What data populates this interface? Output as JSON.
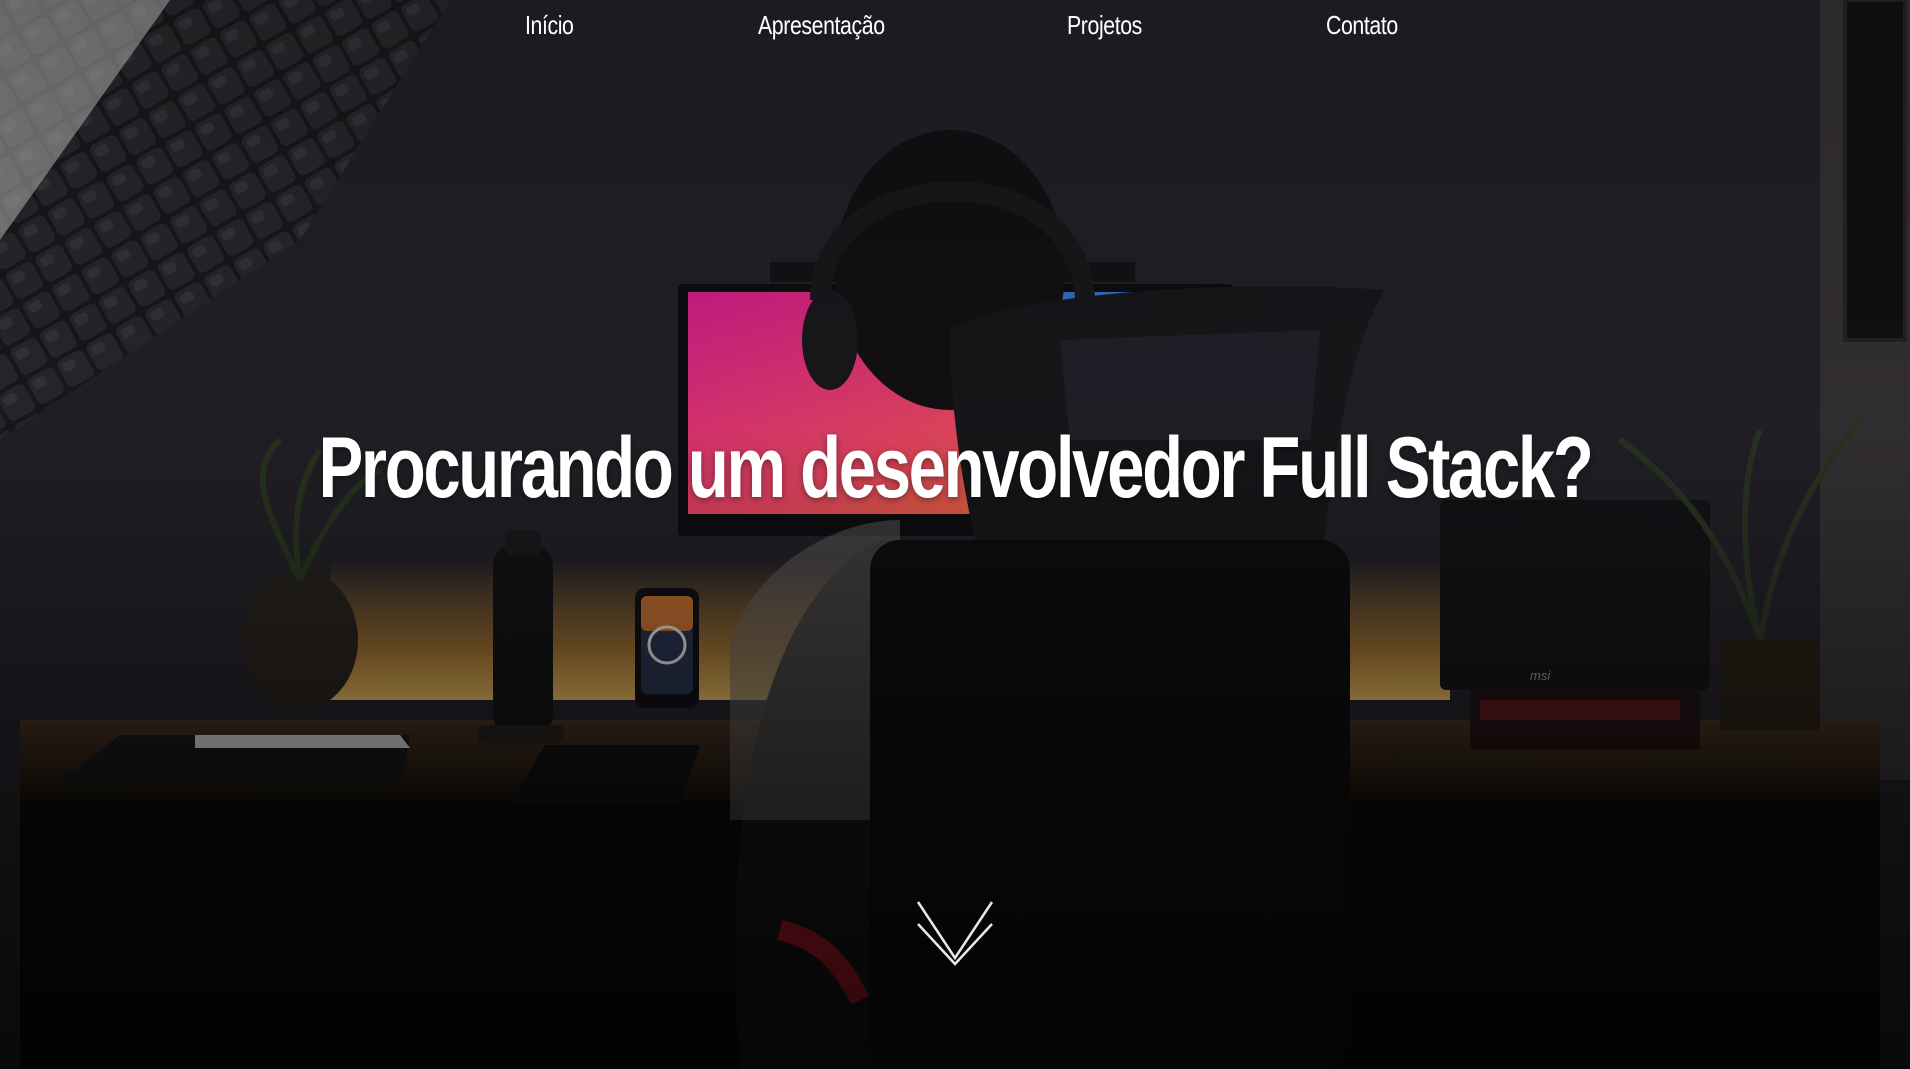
{
  "nav": {
    "items": [
      {
        "label": "Início"
      },
      {
        "label": "Apresentação"
      },
      {
        "label": "Projetos"
      },
      {
        "label": "Contato"
      }
    ]
  },
  "hero": {
    "headline": "Procurando um desenvolvedor Full Stack?",
    "scroll_icon": "chevron-down-icon",
    "laptop_brand": "msi"
  },
  "colors": {
    "text": "#ffffff",
    "background": "#0b0a0d",
    "accent_screen_pink": "#e8209a",
    "accent_screen_orange": "#ff7a2a",
    "accent_led": "#f7a93a"
  }
}
